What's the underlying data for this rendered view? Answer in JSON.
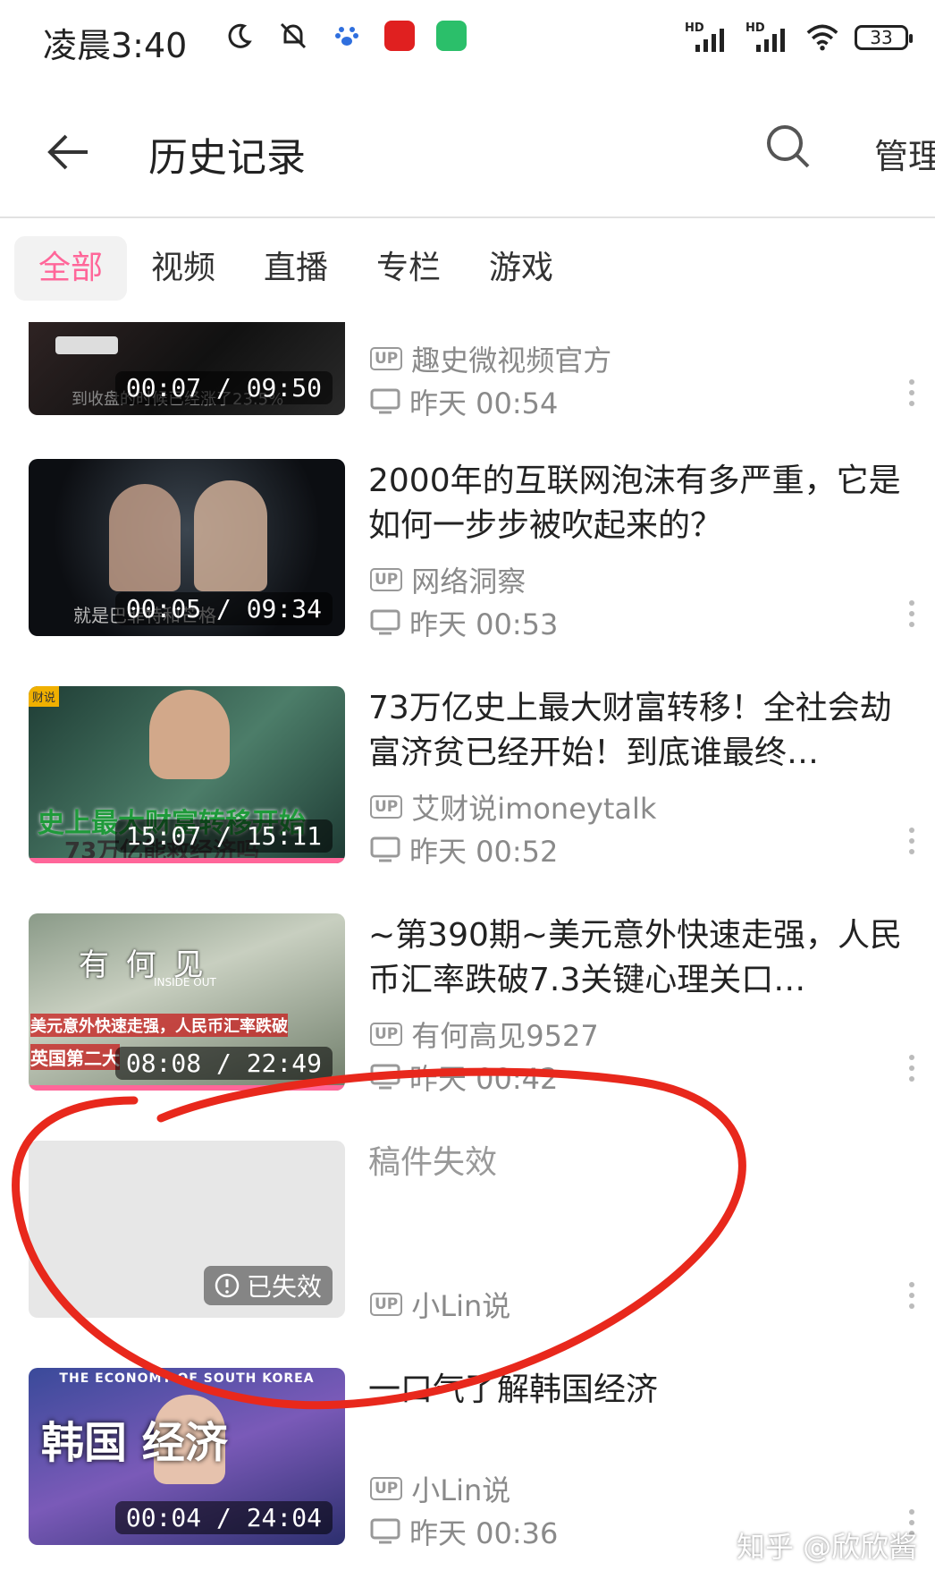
{
  "status_bar": {
    "time": "凌晨3:40",
    "battery": "33",
    "signal_label": "HD"
  },
  "header": {
    "title": "历史记录",
    "manage_label": "管理"
  },
  "tabs": [
    {
      "label": "全部",
      "active": true
    },
    {
      "label": "视频",
      "active": false
    },
    {
      "label": "直播",
      "active": false
    },
    {
      "label": "专栏",
      "active": false
    },
    {
      "label": "游戏",
      "active": false
    }
  ],
  "items": [
    {
      "title": "",
      "up": "趣史微视频官方",
      "time": "昨天 00:54",
      "duration": "00:07 / 09:50",
      "thumb_caption": "到收盘的时候已经涨了23.5%"
    },
    {
      "title": "2000年的互联网泡沫有多严重，它是如何一步步被吹起来的？",
      "up": "网络洞察",
      "time": "昨天 00:53",
      "duration": "00:05 / 09:34",
      "thumb_caption": "就是巴菲特和芒格"
    },
    {
      "title": "73万亿史上最大财富转移！全社会劫富济贫已经开始！到底谁最终…",
      "up": "艾财说imoneytalk",
      "time": "昨天 00:52",
      "duration": "15:07 / 15:11",
      "thumb_caption": "史上最大财富转移开始",
      "thumb_caption2": "73万亿能救经济吗",
      "thumb_tag": "财说"
    },
    {
      "title": "~第390期~美元意外快速走强，人民币汇率跌破7.3关键心理关口…",
      "up": "有何高见9527",
      "time": "昨天 00:42",
      "duration": "08:08 / 22:49",
      "thumb_caption": "美元意外快速走强，人民币汇率跌破",
      "thumb_caption2": "英国第二大",
      "thumb_logo": "有 何 见",
      "thumb_logo_sub": "INSIDE OUT"
    },
    {
      "title": "稿件失效",
      "up": "小Lin说",
      "time": "",
      "invalid_label": "已失效"
    },
    {
      "title": "一口气了解韩国经济",
      "up": "小Lin说",
      "time": "昨天 00:36",
      "duration": "00:04 / 24:04",
      "thumb_caption": "韩国 经济",
      "thumb_banner": "THE ECONOMY OF SOUTH KOREA"
    }
  ],
  "up_badge": "UP",
  "watermark": "知乎 @欣欣酱",
  "colors": {
    "accent": "#ff6699",
    "annotation": "#e8281c"
  }
}
